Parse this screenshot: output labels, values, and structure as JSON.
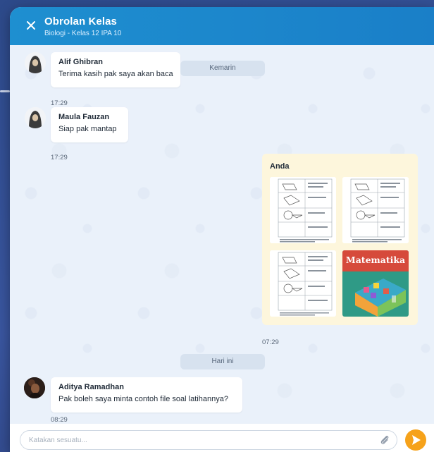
{
  "header": {
    "title": "Obrolan Kelas",
    "subtitle": "Biologi - Kelas 12 IPA 10",
    "close_icon": "close-icon"
  },
  "dates": {
    "yesterday": "Kemarin",
    "today": "Hari ini"
  },
  "messages": [
    {
      "sender": "Alif Ghibran",
      "text": "Terima kasih pak saya akan baca",
      "time": "17:29",
      "avatar_icon": "hooded-avatar-icon"
    },
    {
      "sender": "Maula Fauzan",
      "text": "Siap pak mantap",
      "time": "17:29",
      "avatar_icon": "hooded-avatar-icon"
    },
    {
      "sender": "Anda",
      "attachments": [
        "worksheet-image",
        "worksheet-image",
        "worksheet-image",
        "math-book-cover-image"
      ],
      "book_title": "Matematika",
      "time": "07:29"
    },
    {
      "sender": "Aditya Ramadhan",
      "text": "Pak boleh saya minta contoh file soal latihannya?",
      "time": "08:29",
      "avatar_icon": "photo-avatar-icon"
    }
  ],
  "input": {
    "placeholder": "Katakan sesuatu...",
    "value": "",
    "attach_icon": "paperclip-icon",
    "send_icon": "send-icon"
  },
  "colors": {
    "header": "#1e8fd0",
    "chat_bg": "#eaf1fa",
    "my_bubble": "#fdf6dc",
    "send_button": "#f6a21a",
    "page_bg": "#3a56a0"
  }
}
